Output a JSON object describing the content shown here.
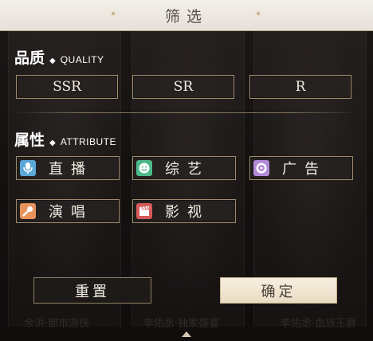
{
  "title": "筛选",
  "background_cards": [
    {
      "caption": "余洪·都市游侠"
    },
    {
      "caption": "李佑丞·独家盛宴"
    },
    {
      "caption": "李佑丞·血族王爵"
    }
  ],
  "quality": {
    "title_zh": "品质",
    "title_en": "QUALITY",
    "options": [
      {
        "label": "SSR"
      },
      {
        "label": "SR"
      },
      {
        "label": "R"
      }
    ]
  },
  "attribute": {
    "title_zh": "属性",
    "title_en": "ATTRIBUTE",
    "options": [
      {
        "label": "直播",
        "icon": "microphone-icon",
        "color": "#5aa7d8"
      },
      {
        "label": "综艺",
        "icon": "smile-icon",
        "color": "#4bb98a"
      },
      {
        "label": "广告",
        "icon": "record-icon",
        "color": "#b38ad9"
      },
      {
        "label": "演唱",
        "icon": "singing-mic-icon",
        "color": "#e8925c"
      },
      {
        "label": "影视",
        "icon": "clapperboard-icon",
        "color": "#d65a5a"
      }
    ]
  },
  "buttons": {
    "reset": "重置",
    "confirm": "确定"
  }
}
